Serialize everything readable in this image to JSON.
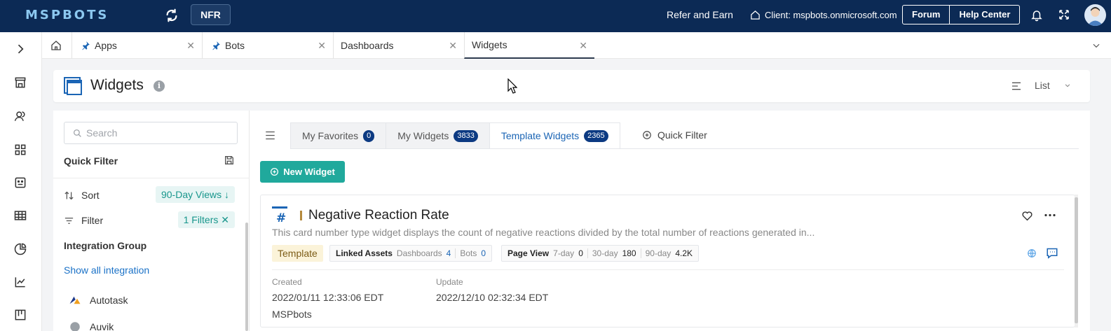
{
  "topbar": {
    "logo": "MSPBOTS",
    "env_button": "NFR",
    "refer": "Refer and Earn",
    "client": "Client: mspbots.onmicrosoft.com",
    "forum": "Forum",
    "help_center": "Help Center"
  },
  "tabs": [
    {
      "label": "Apps",
      "pinned": true
    },
    {
      "label": "Bots",
      "pinned": true
    },
    {
      "label": "Dashboards",
      "pinned": false
    },
    {
      "label": "Widgets",
      "pinned": false,
      "active": true
    }
  ],
  "page": {
    "title": "Widgets",
    "view_mode": "List"
  },
  "sidebar": {
    "search_placeholder": "Search",
    "quick_filter_title": "Quick Filter",
    "sort_label": "Sort",
    "sort_value": "90-Day Views ↓",
    "filter_label": "Filter",
    "filter_value": "1 Filters ✕",
    "integration_group_title": "Integration Group",
    "show_all": "Show all integration",
    "integrations": [
      "Autotask",
      "Auvik"
    ]
  },
  "main": {
    "subtabs": [
      {
        "label": "My Favorites",
        "count": "0"
      },
      {
        "label": "My Widgets",
        "count": "3833"
      },
      {
        "label": "Template Widgets",
        "count": "2365",
        "active": true
      }
    ],
    "quick_filter": "Quick Filter",
    "new_widget": "New Widget"
  },
  "card": {
    "title": "Negative Reaction Rate",
    "description": "This card number type widget displays the count of negative reactions divided by the total number of reactions generated in...",
    "tag": "Template",
    "linked_assets_label": "Linked Assets",
    "dashboards_label": "Dashboards",
    "dashboards_count": "4",
    "bots_label": "Bots",
    "bots_count": "0",
    "page_view_label": "Page View",
    "pv_7_label": "7-day",
    "pv_7": "0",
    "pv_30_label": "30-day",
    "pv_30": "180",
    "pv_90_label": "90-day",
    "pv_90": "4.2K",
    "created_label": "Created",
    "created": "2022/01/11 12:33:06 EDT",
    "update_label": "Update",
    "updated": "2022/12/10 02:32:34 EDT",
    "author": "MSPbots"
  },
  "colors": {
    "topbar": "#0c2a55",
    "accent_teal": "#20a99c",
    "badge": "#0c3a82",
    "link": "#1b72c7"
  }
}
